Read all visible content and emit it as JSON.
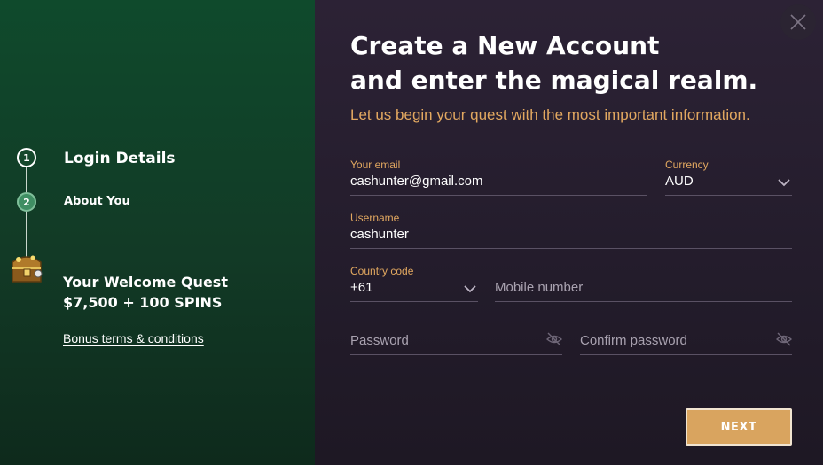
{
  "sidebar": {
    "steps": [
      {
        "number": "1",
        "label": "Login Details"
      },
      {
        "number": "2",
        "label": "About You"
      }
    ],
    "quest": {
      "title": "Your Welcome Quest",
      "amount": "$7,500 + 100 SPINS",
      "terms_link": "Bonus terms & conditions"
    }
  },
  "header": {
    "title_line1": "Create a New Account",
    "title_line2": "and enter the magical realm.",
    "subtitle": "Let us begin your quest with the most important information."
  },
  "form": {
    "email": {
      "label": "Your email",
      "value": "cashunter@gmail.com"
    },
    "currency": {
      "label": "Currency",
      "value": "AUD"
    },
    "username": {
      "label": "Username",
      "value": "cashunter"
    },
    "country_code": {
      "label": "Country code",
      "value": "+61"
    },
    "mobile": {
      "placeholder": "Mobile number"
    },
    "password": {
      "placeholder": "Password"
    },
    "confirm_password": {
      "placeholder": "Confirm password"
    }
  },
  "actions": {
    "next_label": "NEXT"
  },
  "colors": {
    "accent": "#e2a860",
    "button": "#d9a45f",
    "sidebar": "#0f4a2c",
    "panel": "#231c2b"
  },
  "icons": {
    "close": "close-icon",
    "chest": "treasure-chest-icon",
    "eye": "eye-off-icon",
    "chevron": "chevron-down-icon"
  }
}
